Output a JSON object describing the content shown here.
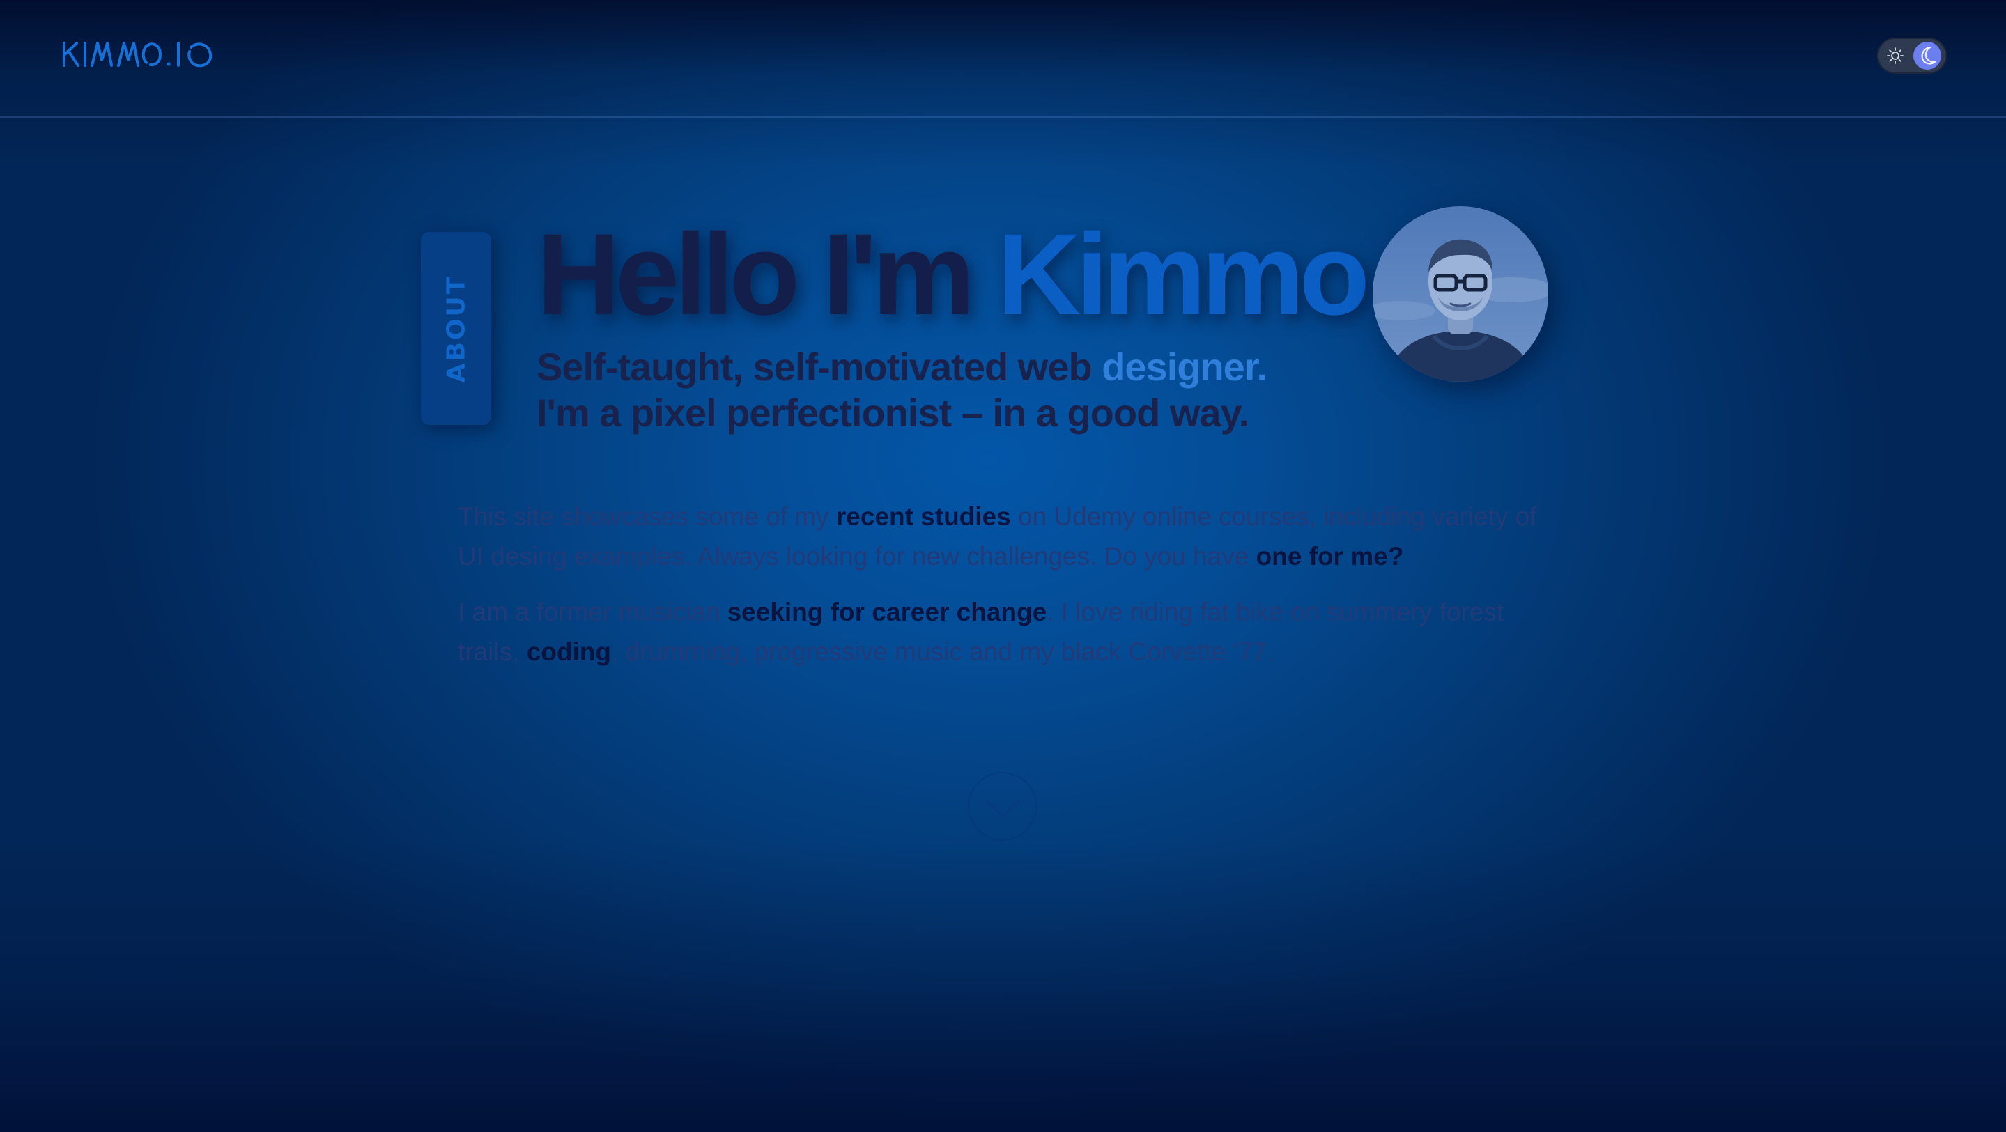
{
  "header": {
    "logo_text": "KIMMO.IO",
    "theme_toggle": {
      "state": "dark",
      "light_icon": "sun-icon",
      "dark_icon": "moon-icon"
    }
  },
  "about_tab": {
    "label": "ABOUT"
  },
  "hero": {
    "title_prefix": "Hello I'm ",
    "title_name": "Kimmo",
    "subtitle_line1_prefix": "Self-taught, self-motivated web ",
    "subtitle_line1_accent": "designer.",
    "subtitle_line2": "I'm a pixel perfectionist – in a good way.",
    "avatar_icon": "profile-photo"
  },
  "intro": {
    "p1": {
      "t1": "This site showcases some of my ",
      "b1": "recent studies",
      "t2": " on Udemy online courses, including variety of UI desing examples. Always looking for new challenges. Do you have ",
      "b2": "one for me?"
    },
    "p2": {
      "t1": "I am a former musician ",
      "b1": "seeking for career change",
      "t2": ". I love riding fat bike on summery forest trails, ",
      "b2": "coding",
      "t3": ", drumming, progressive music and my black Corvette '77."
    }
  },
  "scroll_button": {
    "icon": "chevron-down-icon"
  },
  "colors": {
    "background": "#034a93",
    "heading_dark": "#141e4a",
    "accent_blue": "#0a5ec4",
    "toggle_knob": "#6c7ef0"
  }
}
